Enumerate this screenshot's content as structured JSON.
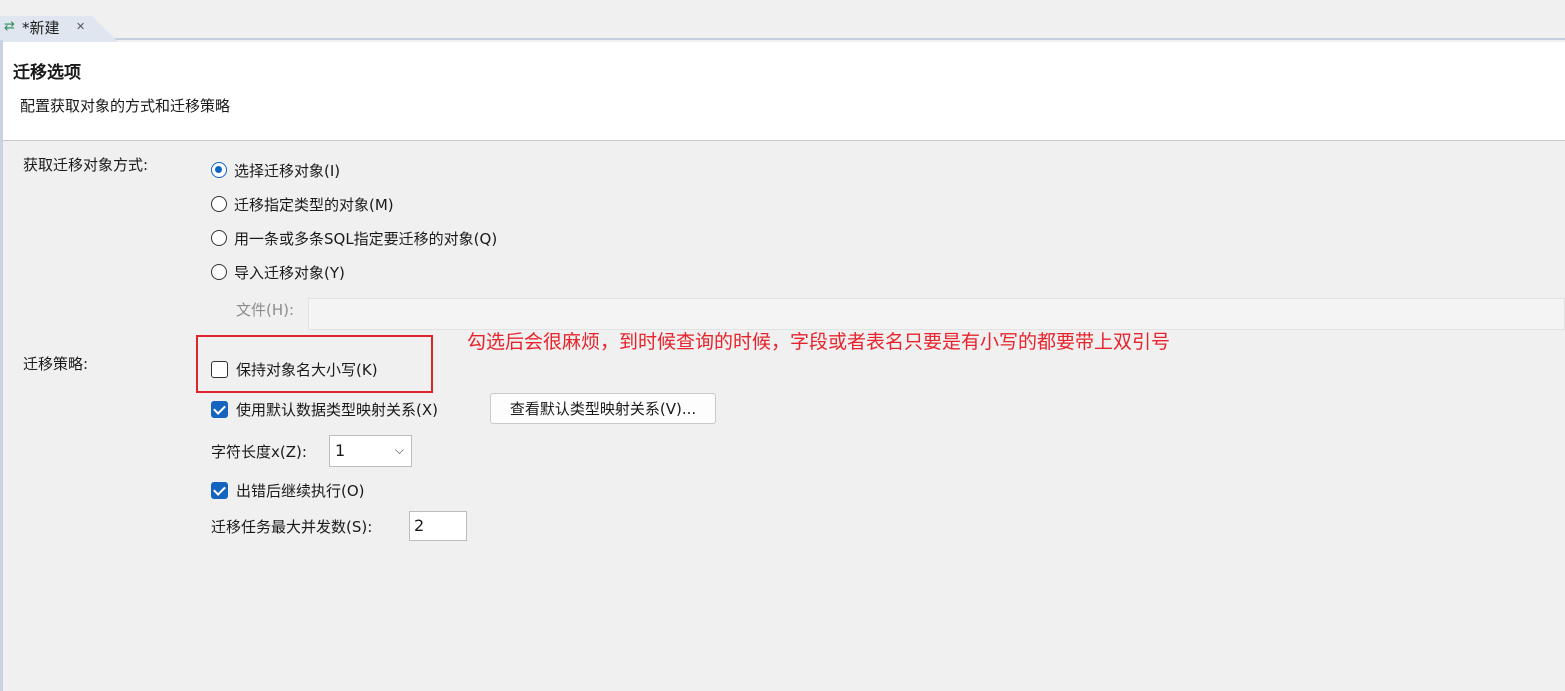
{
  "tab": {
    "icon": "migrate-arrows-icon",
    "label": "*新建",
    "close": "✕"
  },
  "header": {
    "title": "迁移选项",
    "description": "配置获取对象的方式和迁移策略"
  },
  "fetch": {
    "label": "获取迁移对象方式:",
    "options": [
      {
        "label": "选择迁移对象(I)",
        "checked": true
      },
      {
        "label": "迁移指定类型的对象(M)",
        "checked": false
      },
      {
        "label": "用一条或多条SQL指定要迁移的对象(Q)",
        "checked": false
      },
      {
        "label": "导入迁移对象(Y)",
        "checked": false
      }
    ],
    "file_label": "文件(H):",
    "file_value": ""
  },
  "strategy": {
    "label": "迁移策略:",
    "keep_case": {
      "label": "保持对象名大小写(K)",
      "checked": false
    },
    "default_mapping": {
      "label": "使用默认数据类型映射关系(X)",
      "checked": true
    },
    "view_mapping_button": "查看默认类型映射关系(V)...",
    "char_length": {
      "label": "字符长度x(Z):",
      "value": "1"
    },
    "continue_on_error": {
      "label": "出错后继续执行(O)",
      "checked": true
    },
    "max_concurrency": {
      "label": "迁移任务最大并发数(S):",
      "value": "2"
    }
  },
  "annotation": "勾选后会很麻烦，到时候查询的时候，字段或者表名只要是有小写的都要带上双引号",
  "colors": {
    "annotation": "#e8232c",
    "accent": "#1565c0"
  }
}
